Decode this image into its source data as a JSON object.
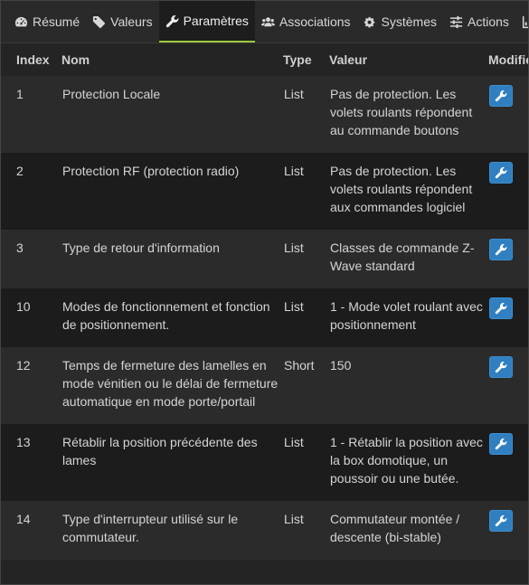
{
  "tabs": [
    {
      "label": "Résumé",
      "icon": "dashboard-icon"
    },
    {
      "label": "Valeurs",
      "icon": "tag-icon"
    },
    {
      "label": "Paramètres",
      "icon": "wrench-icon",
      "active": true
    },
    {
      "label": "Associations",
      "icon": "users-icon"
    },
    {
      "label": "Systèmes",
      "icon": "cogs-icon"
    },
    {
      "label": "Actions",
      "icon": "sliders-icon"
    }
  ],
  "table": {
    "headers": {
      "index": "Index",
      "nom": "Nom",
      "type": "Type",
      "valeur": "Valeur",
      "modifier": "Modifier"
    },
    "rows": [
      {
        "index": "1",
        "nom": "Protection Locale",
        "type": "List",
        "valeur": "Pas de protection. Les volets roulants répondent au commande boutons"
      },
      {
        "index": "2",
        "nom": "Protection RF (protection radio)",
        "type": "List",
        "valeur": "Pas de protection. Les volets roulants répondent aux commandes logiciel"
      },
      {
        "index": "3",
        "nom": "Type de retour d'information",
        "type": "List",
        "valeur": "Classes de commande Z-Wave standard"
      },
      {
        "index": "10",
        "nom": "Modes de fonctionnement et fonction de positionnement.",
        "type": "List",
        "valeur": "1 - Mode volet roulant avec positionnement"
      },
      {
        "index": "12",
        "nom": "Temps de fermeture des lamelles en mode vénitien ou le délai de fermeture automatique en mode porte/portail",
        "type": "Short",
        "valeur": "150"
      },
      {
        "index": "13",
        "nom": "Rétablir la position précédente des lames",
        "type": "List",
        "valeur": "1 - Rétablir la position avec la box domotique, un poussoir ou une butée."
      },
      {
        "index": "14",
        "nom": "Type d'interrupteur utilisé sur le commutateur.",
        "type": "List",
        "valeur": "Commutateur montée / descente (bi-stable)"
      }
    ]
  }
}
